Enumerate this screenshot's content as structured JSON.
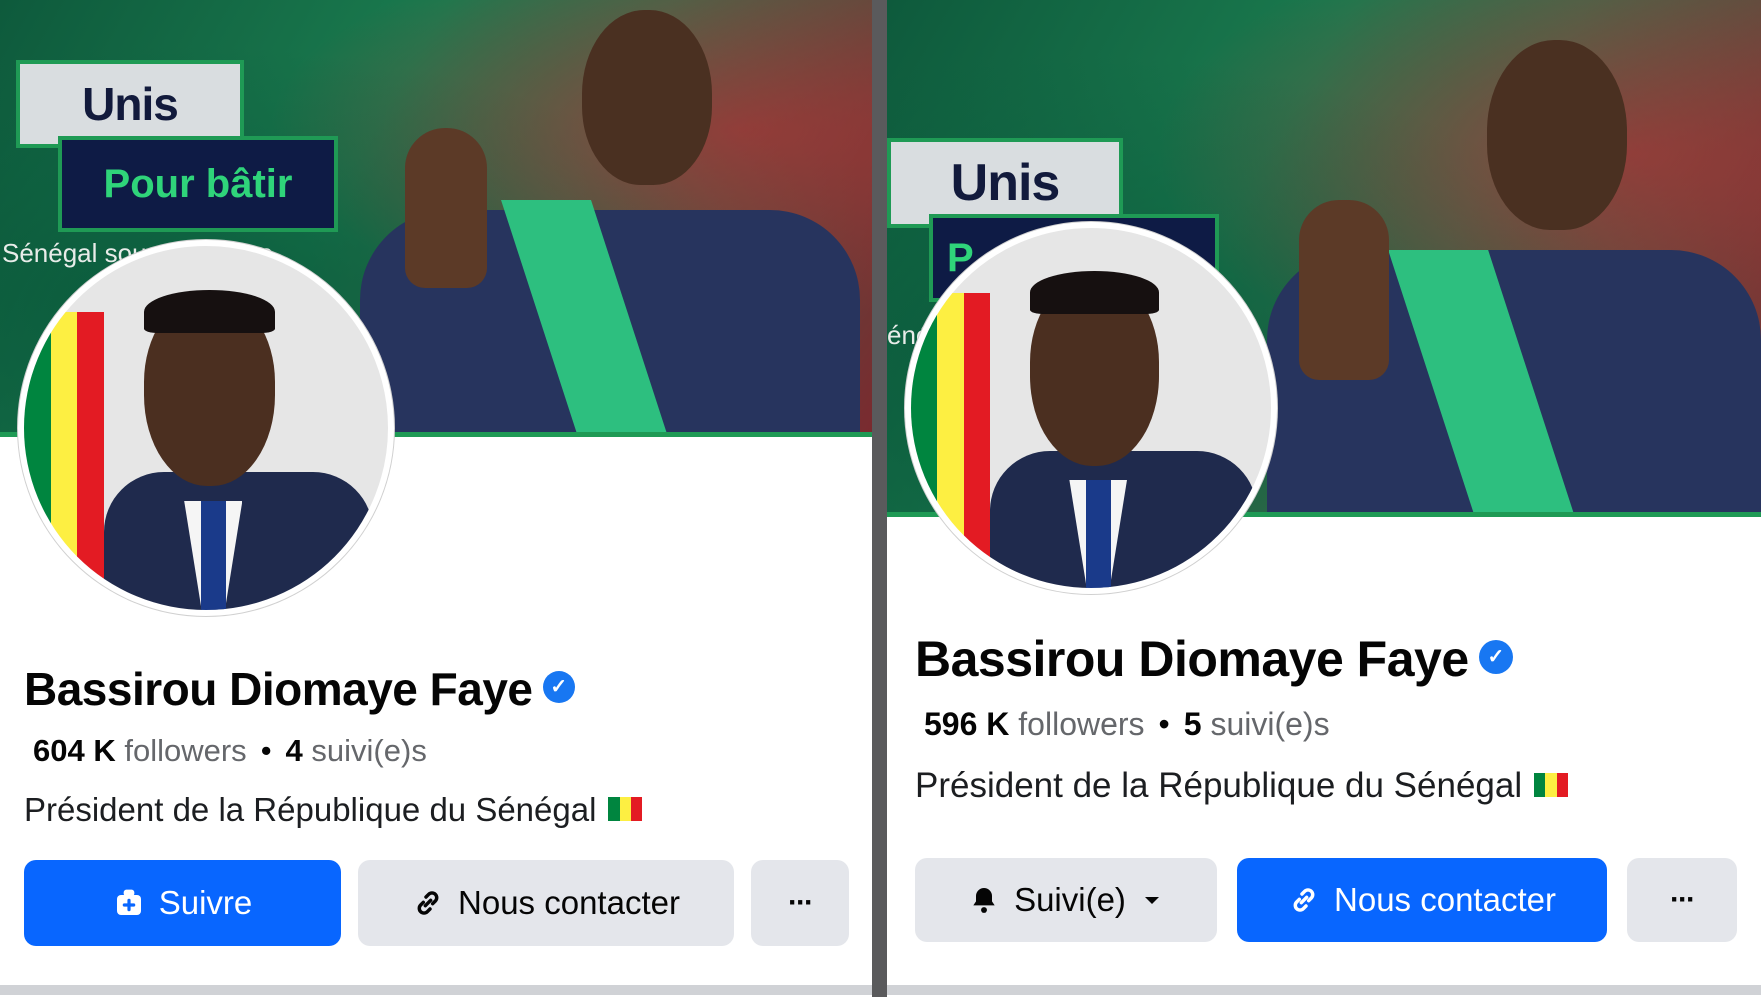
{
  "left": {
    "cover": {
      "slogan_line1": "Unis",
      "slogan_line2": "Pour bâtir",
      "slogan_sub": "Sénégal souv... ...spère"
    },
    "profile": {
      "name": "Bassirou Diomaye Faye",
      "followers_count": "604 K",
      "followers_label": "followers",
      "following_count": "4",
      "following_label": "suivi(e)s",
      "bio": "Président de la République du Sénégal"
    },
    "buttons": {
      "follow": "Suivre",
      "contact": "Nous contacter",
      "more": "···"
    }
  },
  "right": {
    "cover": {
      "slogan_line1": "Unis",
      "slogan_line2": "P",
      "slogan_sub": "éné"
    },
    "profile": {
      "name": "Bassirou Diomaye Faye",
      "followers_count": "596 K",
      "followers_label": "followers",
      "following_count": "5",
      "following_label": "suivi(e)s",
      "bio": "Président de la République du Sénégal"
    },
    "buttons": {
      "following": "Suivi(e)",
      "contact": "Nous contacter",
      "more": "···"
    }
  },
  "colors": {
    "facebook_blue": "#0866ff",
    "verified_blue": "#1877f2",
    "button_gray": "#e4e6eb",
    "cover_green": "#1f9a55",
    "flag_green": "#00853f",
    "flag_yellow": "#fdef42",
    "flag_red": "#e31b23"
  },
  "icons": [
    "verified-badge-icon",
    "follow-plus-icon",
    "link-icon",
    "bell-icon",
    "caret-down-icon",
    "more-icon",
    "senegal-flag-icon"
  ]
}
